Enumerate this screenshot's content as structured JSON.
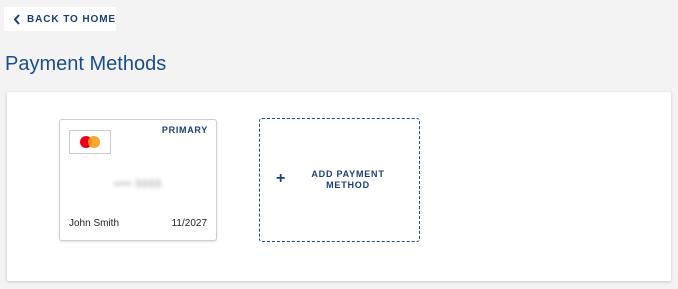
{
  "nav": {
    "back_label": "BACK TO HOME"
  },
  "page": {
    "title": "Payment Methods"
  },
  "cards": [
    {
      "brand_icon": "mastercard-icon",
      "badge": "PRIMARY",
      "masked_number": "•••• 5555",
      "holder": "John Smith",
      "expiry": "11/2027"
    }
  ],
  "add_payment": {
    "icon": "plus-icon",
    "label": "ADD PAYMENT METHOD"
  },
  "colors": {
    "accent": "#1c4c8c",
    "label_dark": "#1c3f75",
    "background": "#f3f3f3",
    "mastercard_red": "#eb001b",
    "mastercard_orange": "#f79e1b"
  }
}
